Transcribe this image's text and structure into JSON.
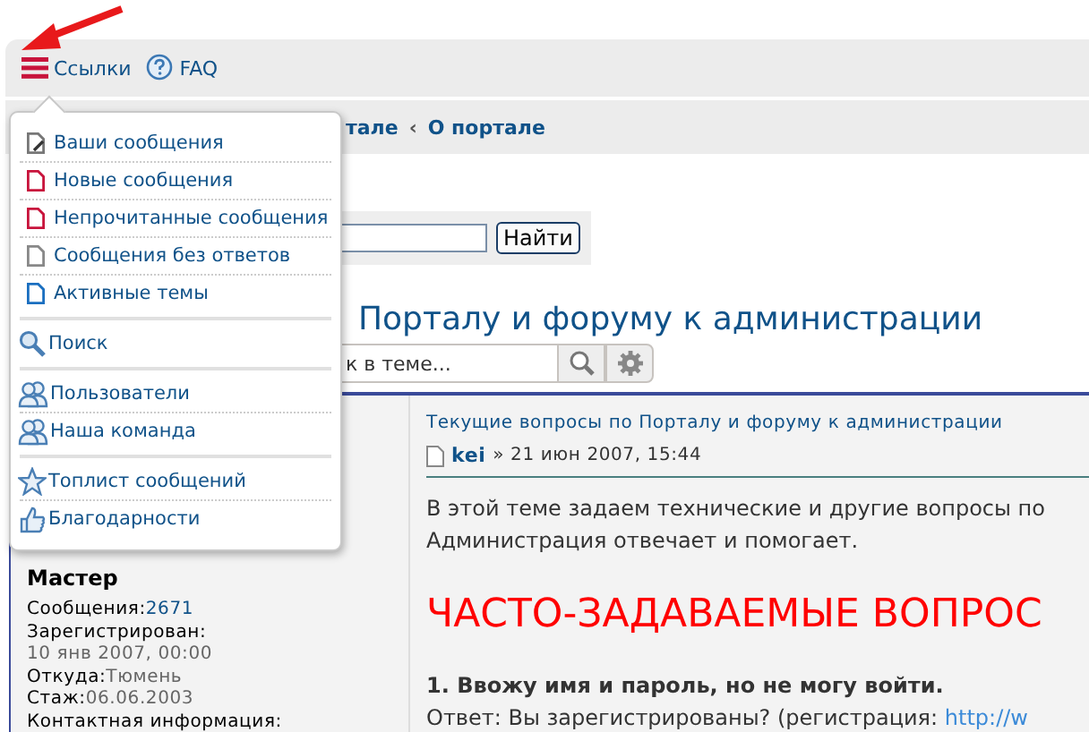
{
  "navbar": {
    "items": [
      {
        "label": "Ссылки",
        "kind": "menu",
        "expanded": true
      },
      {
        "label": "FAQ",
        "kind": "help"
      }
    ]
  },
  "dropdown": {
    "groups": [
      [
        {
          "label": "Ваши сообщения",
          "kind": "mine"
        },
        {
          "label": "Новые сообщения",
          "kind": "new"
        },
        {
          "label": "Непрочитанные сообщения",
          "kind": "unread"
        },
        {
          "label": "Сообщения без ответов",
          "kind": "noreply"
        },
        {
          "label": "Активные темы",
          "kind": "active"
        }
      ],
      [
        {
          "label": "Поиск",
          "kind": "search"
        }
      ],
      [
        {
          "label": "Пользователи",
          "kind": "users"
        },
        {
          "label": "Наша команда",
          "kind": "team"
        }
      ],
      [
        {
          "label": "Топлист сообщений",
          "kind": "top"
        },
        {
          "label": "Благодарности",
          "kind": "thanks"
        }
      ]
    ]
  },
  "breadcrumbs": {
    "separator": "‹",
    "items": [
      "тале",
      "О портале"
    ]
  },
  "search": {
    "button": "Найти"
  },
  "topic": {
    "title": "Порталу и форуму к администрации",
    "search": {
      "placeholder": "к в теме..."
    }
  },
  "profile": {
    "rank": "Мастер",
    "fields": [
      {
        "label": "Сообщения:",
        "value": "2671",
        "kind": "link"
      },
      {
        "label": "Зарегистрирован:",
        "value": "10 янв 2007, 00:00",
        "kind": "block"
      },
      {
        "label": "Откуда:",
        "value": "Тюмень",
        "kind": "inline"
      },
      {
        "label": "Стаж:",
        "value": "06.06.2003",
        "kind": "inline"
      },
      {
        "label": "Контактная информация:",
        "kind": "label"
      }
    ]
  },
  "post": {
    "topic_link": "Текущие вопросы по Порталу и форуму к администрации",
    "author": "kei",
    "date": "» 21 июн 2007, 15:44",
    "intro": [
      "В этой теме задаем технические и другие вопросы по",
      "Администрация отвечает и помогает."
    ],
    "heading": "ЧАСТО-ЗАДАВАЕМЫЕ ВОПРОС",
    "question": "1. Ввожу имя и пароль, но не могу войти.",
    "answer": "Ответ: Вы зарегистрированы? (регистрация:",
    "answer_link": "http://w"
  }
}
